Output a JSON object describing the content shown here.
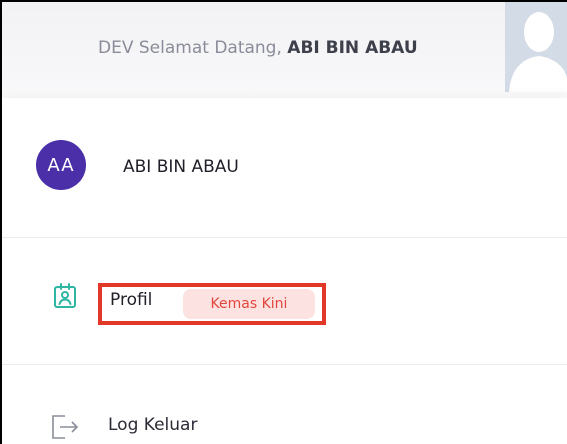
{
  "header": {
    "env_label": "DEV",
    "greeting": "Selamat Datang,",
    "user_name": "ABI BIN ABAU"
  },
  "user_menu": {
    "initials": "AA",
    "name": "ABI BIN ABAU",
    "items": [
      {
        "label": "Profil",
        "badge": "Kemas Kini",
        "icon": "profile-card-icon"
      },
      {
        "label": "Log Keluar",
        "icon": "logout-icon"
      }
    ]
  },
  "colors": {
    "avatar_bg": "#4a2fa8",
    "badge_bg": "#fde2e2",
    "badge_text": "#e2473d",
    "highlight": "#e2382a",
    "profile_icon": "#2fb5a3"
  }
}
